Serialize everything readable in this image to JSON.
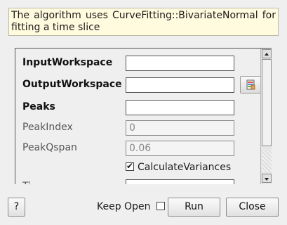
{
  "description": "The algorithm uses CurveFitting::BivariateNormal for fitting a time slice",
  "properties": [
    {
      "label": "InputWorkspace",
      "value": ""
    },
    {
      "label": "OutputWorkspace",
      "value": ""
    },
    {
      "label": "Peaks",
      "value": ""
    },
    {
      "label": "PeakIndex",
      "value": "0"
    },
    {
      "label": "PeakQspan",
      "value": "0.06"
    },
    {
      "label": "CalculateVariances",
      "checked": true
    },
    {
      "label": "Ti",
      "value": ""
    }
  ],
  "icons": {
    "browse": "workspace-browse-icon",
    "check": "checkmark-icon"
  },
  "footer": {
    "help_label": "?",
    "keep_open_label": "Keep Open",
    "keep_open_checked": false,
    "run_label": "Run",
    "close_label": "Close"
  }
}
